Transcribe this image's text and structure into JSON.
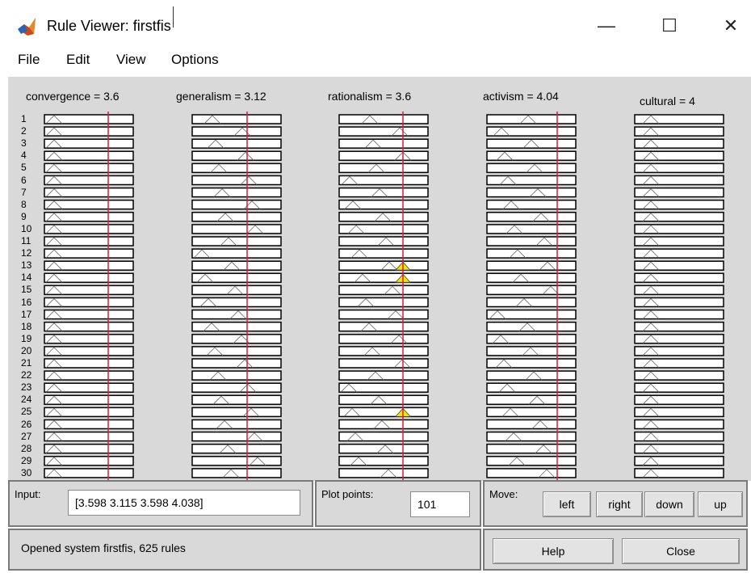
{
  "window": {
    "title": "Rule Viewer: firstfis",
    "minimize_glyph": "—",
    "maximize_glyph": "☐",
    "close_glyph": "✕"
  },
  "menu": [
    "File",
    "Edit",
    "View",
    "Options"
  ],
  "variables": [
    {
      "label": "convergence = 3.6",
      "value": 3.6
    },
    {
      "label": "generalism = 3.12",
      "value": 3.12
    },
    {
      "label": "rationalism = 3.6",
      "value": 3.6
    },
    {
      "label": "activism = 4.04",
      "value": 4.04
    },
    {
      "label": "cultural = 4",
      "value": 4
    }
  ],
  "rule_numbers": [
    "1",
    "2",
    "3",
    "4",
    "5",
    "6",
    "7",
    "8",
    "9",
    "10",
    "11",
    "12",
    "13",
    "14",
    "15",
    "16",
    "17",
    "18",
    "19",
    "20",
    "21",
    "22",
    "23",
    "24",
    "25",
    "26",
    "27",
    "28",
    "29",
    "30"
  ],
  "highlighted_rules": [
    "13",
    "14",
    "25"
  ],
  "colors": {
    "indicator_line": "#d81b3c",
    "fired_fill": "#f2e600",
    "panel_bg": "#d9d9d9",
    "bar_border": "#000000"
  },
  "controls": {
    "input_label": "Input:",
    "input_value": "[3.598 3.115 3.598 4.038]",
    "plot_points_label": "Plot points:",
    "plot_points_value": "101",
    "move_label": "Move:",
    "move_buttons": [
      "left",
      "right",
      "down",
      "up"
    ],
    "status": "Opened system firstfis, 625 rules",
    "help_label": "Help",
    "close_label": "Close"
  }
}
